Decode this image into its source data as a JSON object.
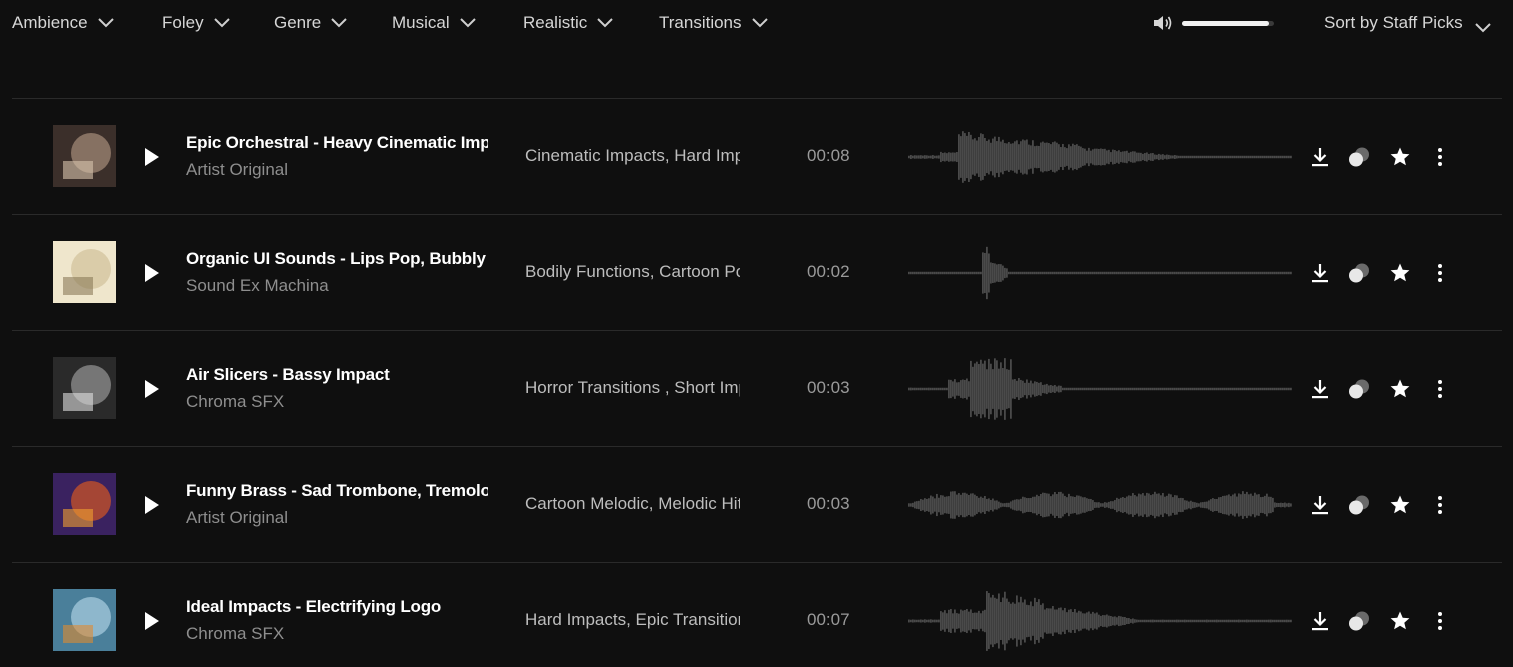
{
  "filters": [
    {
      "label": "Ambience"
    },
    {
      "label": "Foley"
    },
    {
      "label": "Genre"
    },
    {
      "label": "Musical"
    },
    {
      "label": "Realistic"
    },
    {
      "label": "Transitions"
    }
  ],
  "volume": {
    "level": 0.95
  },
  "sort": {
    "label": "Sort by Staff Picks"
  },
  "tracks": [
    {
      "title": "Epic Orchestral - Heavy Cinematic Impact",
      "artist": "Artist Original",
      "tags": "Cinematic Impacts, Hard Impacts",
      "duration": "00:08",
      "cover_colors": [
        "#3b2f2a",
        "#9a8270",
        "#d8c4ae"
      ]
    },
    {
      "title": "Organic UI Sounds - Lips Pop, Bubbly",
      "artist": "Sound Ex Machina",
      "tags": "Bodily Functions, Cartoon Pops",
      "duration": "00:02",
      "cover_colors": [
        "#efe6cc",
        "#d4c6a0",
        "#8a7a58"
      ]
    },
    {
      "title": "Air Slicers - Bassy Impact",
      "artist": "Chroma SFX",
      "tags": "Horror Transitions , Short Impacts",
      "duration": "00:03",
      "cover_colors": [
        "#2a2a2a",
        "#8a8a8a",
        "#e0e0e0"
      ]
    },
    {
      "title": "Funny Brass - Sad Trombone, Tremolo",
      "artist": "Artist Original",
      "tags": "Cartoon Melodic, Melodic Hits",
      "duration": "00:03",
      "cover_colors": [
        "#3a2260",
        "#c0502a",
        "#f0a030"
      ]
    },
    {
      "title": "Ideal Impacts - Electrifying Logo",
      "artist": "Chroma SFX",
      "tags": "Hard Impacts, Epic Transitions",
      "duration": "00:07",
      "cover_colors": [
        "#4a7f9a",
        "#9fc6d8",
        "#e08a30"
      ]
    }
  ],
  "icons": {
    "chevron": "chevron-down-icon",
    "speaker": "speaker-icon",
    "play": "play-icon",
    "download": "download-icon",
    "collection": "collection-icon",
    "favorite": "star-icon",
    "more": "more-vertical-icon"
  },
  "colors": {
    "background": "#0f0f0f",
    "divider": "#2a2a2a",
    "waveform": "#4a4a4a",
    "secondary_text": "#8e8e8e"
  }
}
